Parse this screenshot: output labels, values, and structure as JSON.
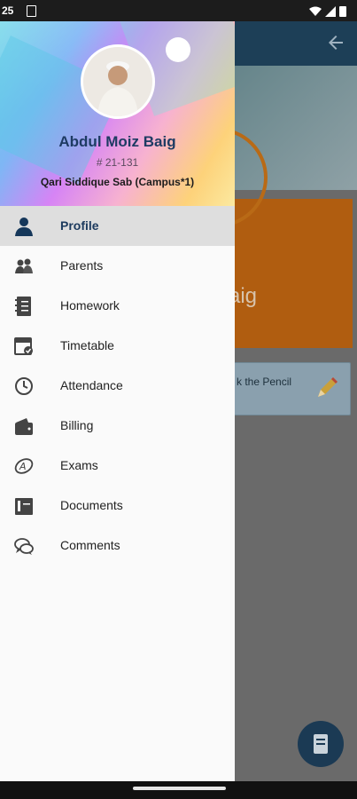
{
  "status_bar": {
    "time": "25"
  },
  "drawer": {
    "student_name": "Abdul Moiz Baig",
    "student_id": "# 21-131",
    "campus": "Qari Siddique Sab (Campus*1)",
    "menu": [
      {
        "label": "Profile",
        "icon": "person-icon",
        "active": true
      },
      {
        "label": "Parents",
        "icon": "parents-icon",
        "active": false
      },
      {
        "label": "Homework",
        "icon": "notebook-icon",
        "active": false
      },
      {
        "label": "Timetable",
        "icon": "calendar-check-icon",
        "active": false
      },
      {
        "label": "Attendance",
        "icon": "clock-icon",
        "active": false
      },
      {
        "label": "Billing",
        "icon": "wallet-icon",
        "active": false
      },
      {
        "label": "Exams",
        "icon": "exam-icon",
        "active": false
      },
      {
        "label": "Documents",
        "icon": "folder-icon",
        "active": false
      },
      {
        "label": "Comments",
        "icon": "chat-icon",
        "active": false
      }
    ]
  },
  "background": {
    "name_fragment": "aig",
    "card_text": "k the Pencil"
  },
  "colors": {
    "header": "#1d3f57",
    "active_text": "#1c3a5e",
    "orange": "#b05d10"
  }
}
